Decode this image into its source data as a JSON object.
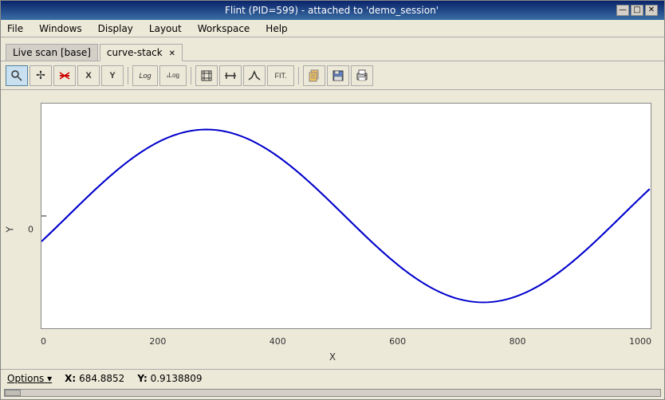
{
  "window": {
    "title": "Flint (PID=599) - attached to 'demo_session'"
  },
  "titlebar": {
    "minimize_label": "—",
    "maximize_label": "□",
    "close_label": "✕"
  },
  "menu": {
    "items": [
      "File",
      "Windows",
      "Display",
      "Layout",
      "Workspace",
      "Help"
    ]
  },
  "tabs": [
    {
      "label": "Live scan [base]",
      "active": false,
      "closeable": false
    },
    {
      "label": "curve-stack",
      "active": true,
      "closeable": true
    }
  ],
  "toolbar": {
    "buttons": [
      {
        "icon": "🔍",
        "name": "zoom-tool",
        "tooltip": "Zoom",
        "active": true
      },
      {
        "icon": "✢",
        "name": "pan-tool",
        "tooltip": "Pan"
      },
      {
        "icon": "✗",
        "name": "reset-view",
        "tooltip": "Reset"
      },
      {
        "icon": "X",
        "name": "x-axis-log",
        "tooltip": "X axis"
      },
      {
        "icon": "Y",
        "name": "y-axis-log",
        "tooltip": "Y axis"
      },
      {
        "sep": true
      },
      {
        "icon": "Log",
        "name": "log-x",
        "tooltip": "Log X"
      },
      {
        "icon": "xLog",
        "name": "log-x2",
        "tooltip": "Log X2"
      },
      {
        "sep": true
      },
      {
        "icon": "⊞",
        "name": "grid",
        "tooltip": "Grid"
      },
      {
        "icon": "⥥",
        "name": "autoscale",
        "tooltip": "Autoscale"
      },
      {
        "icon": "⛰",
        "name": "peak",
        "tooltip": "Peak"
      },
      {
        "icon": "Fit.",
        "name": "fit",
        "tooltip": "Fit"
      },
      {
        "sep": true
      },
      {
        "icon": "📋",
        "name": "copy",
        "tooltip": "Copy"
      },
      {
        "icon": "💾",
        "name": "save",
        "tooltip": "Save"
      },
      {
        "icon": "🖨",
        "name": "print",
        "tooltip": "Print"
      }
    ]
  },
  "plot": {
    "y_label": "Y",
    "x_label": "X",
    "x_ticks": [
      "0",
      "200",
      "400",
      "600",
      "800",
      "1000"
    ],
    "y_tick": "0",
    "curve_color": "#0000cc"
  },
  "statusbar": {
    "options_label": "Options",
    "x_label": "X:",
    "x_value": "684.8852",
    "y_label": "Y:",
    "y_value": "0.9138809"
  },
  "scrollbar": {
    "value": 0
  }
}
